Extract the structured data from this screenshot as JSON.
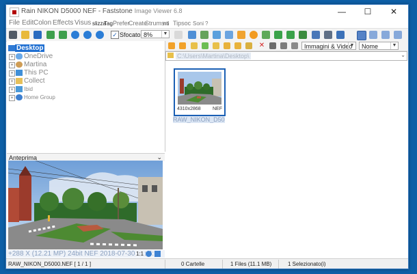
{
  "window": {
    "title": "Rain NIKON D5000 NEF - Faststone",
    "title_suffix": "Image Viewer 6.8",
    "minimize": "—",
    "maximize": "☐",
    "close": "✕"
  },
  "menu": {
    "items": [
      "File",
      "Edit",
      "Colon",
      "Effects",
      "Visus"
    ],
    "small_items": [
      "slizza",
      "Tag",
      "Prefer",
      "Create",
      "Strums",
      "nti",
      "Tipsoc",
      "Soni",
      "?"
    ]
  },
  "toolbar": {
    "blur_label": "Sfocato",
    "blur_checked": true,
    "zoom_value": "8%",
    "hand_icon": "hand-icon"
  },
  "tree": {
    "items": [
      {
        "label": "Desktop",
        "selected": true,
        "icon": "desktop-icon"
      },
      {
        "label": "OneDrive",
        "icon": "cloud-icon"
      },
      {
        "label": "Martina",
        "icon": "user-icon"
      },
      {
        "label": "This PC",
        "icon": "computer-icon"
      },
      {
        "label": "Collect",
        "icon": "folder-icon"
      },
      {
        "label": "Ibid",
        "icon": "library-icon"
      },
      {
        "label": "Home Group",
        "icon": "homegroup-icon"
      }
    ]
  },
  "preview": {
    "header": "Anteprima",
    "collapse_glyph": "⌄",
    "info": "+288 X (12.21 MP) 24bit NEF 2018-07-30 10: 4:",
    "ratio": "1:1"
  },
  "browser": {
    "filter": "Immagini & Video",
    "sort": "Nome",
    "path": "C:\\Users\\Martina\\Desktop\\",
    "thumb": {
      "dimensions": "4310x2868",
      "format": "NEF",
      "name": "RAW_NIKON_D5000..."
    }
  },
  "status": {
    "file": "RAW_NIKON_D5000.NEF [ 1 / 1 ]",
    "folders": "0 Cartelle",
    "files": "1 Files (11.1 MB)",
    "selected": "1 Selezionato(i)"
  },
  "colors": {
    "accent": "#1a5fb4",
    "desktop_bg": "#0d5fa6",
    "selection": "#1f6fd1"
  }
}
